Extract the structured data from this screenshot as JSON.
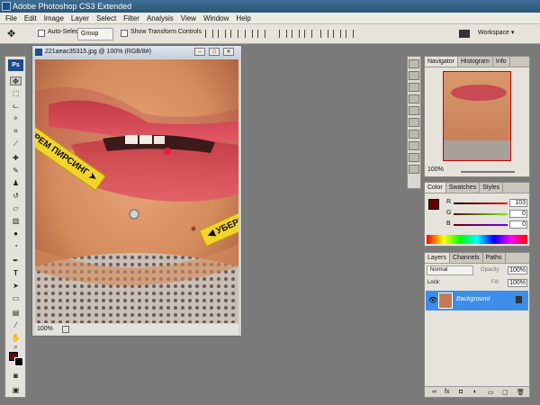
{
  "window": {
    "title": "Adobe Photoshop CS3 Extended"
  },
  "menu": [
    "File",
    "Edit",
    "Image",
    "Layer",
    "Select",
    "Filter",
    "Analysis",
    "View",
    "Window",
    "Help"
  ],
  "options": {
    "auto_select_label": "Auto-Select:",
    "auto_select_value": "Group",
    "show_transform_label": "Show Transform Controls",
    "workspace_label": "Workspace ▾"
  },
  "toolbox": {
    "logo": "Ps"
  },
  "document": {
    "title": "221aeac35315.jpg @ 100% (RGB/8#)",
    "zoom": "100%"
  },
  "annotations": {
    "banner1": "УБЕРЕМ ПИРСИНГ",
    "banner2": "УБЕРЕМ ПРЫЩИК"
  },
  "navigator": {
    "tabs": [
      "Navigator",
      "Histogram",
      "Info"
    ],
    "zoom": "100%"
  },
  "color": {
    "tabs": [
      "Color",
      "Swatches",
      "Styles"
    ],
    "r_label": "R",
    "r_value": "103",
    "g_label": "G",
    "g_value": "0",
    "b_label": "B",
    "b_value": "0",
    "foreground": "#670000"
  },
  "layers": {
    "tabs": [
      "Layers",
      "Channels",
      "Paths"
    ],
    "blend_mode": "Normal",
    "opacity_label": "Opacity:",
    "opacity_value": "100%",
    "lock_label": "Lock:",
    "fill_label": "Fill:",
    "fill_value": "100%",
    "layer_name": "Background"
  }
}
